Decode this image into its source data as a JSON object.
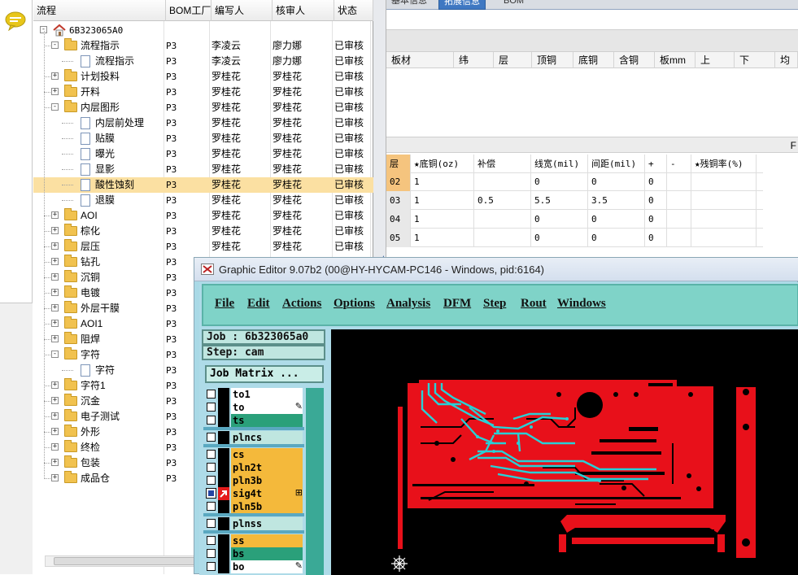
{
  "tree": {
    "headers": {
      "flow": "流程",
      "bom": "BOM工厂",
      "writer": "编写人",
      "auditor": "核审人",
      "status": "状态"
    },
    "root": "6B323065A0",
    "rows": [
      {
        "level": 1,
        "type": "folder",
        "expander": "-",
        "label": "流程指示",
        "bom": "P3",
        "writer": "李凌云",
        "auditor": "廖力娜",
        "status": "已审核"
      },
      {
        "level": 2,
        "type": "doc",
        "expander": "",
        "label": "流程指示",
        "bom": "P3",
        "writer": "李凌云",
        "auditor": "廖力娜",
        "status": "已审核"
      },
      {
        "level": 1,
        "type": "folder",
        "expander": "+",
        "label": "计划投料",
        "bom": "P3",
        "writer": "罗桂花",
        "auditor": "罗桂花",
        "status": "已审核"
      },
      {
        "level": 1,
        "type": "folder",
        "expander": "+",
        "label": "开料",
        "bom": "P3",
        "writer": "罗桂花",
        "auditor": "罗桂花",
        "status": "已审核"
      },
      {
        "level": 1,
        "type": "folder",
        "expander": "-",
        "label": "内层图形",
        "bom": "P3",
        "writer": "罗桂花",
        "auditor": "罗桂花",
        "status": "已审核"
      },
      {
        "level": 2,
        "type": "doc",
        "expander": "",
        "label": "内层前处理",
        "bom": "P3",
        "writer": "罗桂花",
        "auditor": "罗桂花",
        "status": "已审核"
      },
      {
        "level": 2,
        "type": "doc",
        "expander": "",
        "label": "贴膜",
        "bom": "P3",
        "writer": "罗桂花",
        "auditor": "罗桂花",
        "status": "已审核"
      },
      {
        "level": 2,
        "type": "doc",
        "expander": "",
        "label": "曝光",
        "bom": "P3",
        "writer": "罗桂花",
        "auditor": "罗桂花",
        "status": "已审核"
      },
      {
        "level": 2,
        "type": "doc",
        "expander": "",
        "label": "显影",
        "bom": "P3",
        "writer": "罗桂花",
        "auditor": "罗桂花",
        "status": "已审核"
      },
      {
        "level": 2,
        "type": "doc",
        "expander": "",
        "label": "酸性蚀刻",
        "bom": "P3",
        "writer": "罗桂花",
        "auditor": "罗桂花",
        "status": "已审核",
        "selected": true
      },
      {
        "level": 2,
        "type": "doc",
        "expander": "",
        "label": "退膜",
        "bom": "P3",
        "writer": "罗桂花",
        "auditor": "罗桂花",
        "status": "已审核"
      },
      {
        "level": 1,
        "type": "folder",
        "expander": "+",
        "label": "AOI",
        "bom": "P3",
        "writer": "罗桂花",
        "auditor": "罗桂花",
        "status": "已审核"
      },
      {
        "level": 1,
        "type": "folder",
        "expander": "+",
        "label": "棕化",
        "bom": "P3",
        "writer": "罗桂花",
        "auditor": "罗桂花",
        "status": "已审核"
      },
      {
        "level": 1,
        "type": "folder",
        "expander": "+",
        "label": "层压",
        "bom": "P3",
        "writer": "罗桂花",
        "auditor": "罗桂花",
        "status": "已审核"
      },
      {
        "level": 1,
        "type": "folder",
        "expander": "+",
        "label": "钻孔",
        "bom": "P3",
        "writer": "",
        "auditor": "",
        "status": ""
      },
      {
        "level": 1,
        "type": "folder",
        "expander": "+",
        "label": "沉铜",
        "bom": "P3",
        "writer": "",
        "auditor": "",
        "status": ""
      },
      {
        "level": 1,
        "type": "folder",
        "expander": "+",
        "label": "电镀",
        "bom": "P3",
        "writer": "",
        "auditor": "",
        "status": ""
      },
      {
        "level": 1,
        "type": "folder",
        "expander": "+",
        "label": "外层干膜",
        "bom": "P3",
        "writer": "",
        "auditor": "",
        "status": ""
      },
      {
        "level": 1,
        "type": "folder",
        "expander": "+",
        "label": "AOI1",
        "bom": "P3",
        "writer": "",
        "auditor": "",
        "status": ""
      },
      {
        "level": 1,
        "type": "folder",
        "expander": "+",
        "label": "阻焊",
        "bom": "P3",
        "writer": "",
        "auditor": "",
        "status": ""
      },
      {
        "level": 1,
        "type": "folder",
        "expander": "-",
        "label": "字符",
        "bom": "P3",
        "writer": "",
        "auditor": "",
        "status": ""
      },
      {
        "level": 2,
        "type": "doc",
        "expander": "",
        "label": "字符",
        "bom": "P3",
        "writer": "",
        "auditor": "",
        "status": ""
      },
      {
        "level": 1,
        "type": "folder",
        "expander": "+",
        "label": "字符1",
        "bom": "P3",
        "writer": "",
        "auditor": "",
        "status": ""
      },
      {
        "level": 1,
        "type": "folder",
        "expander": "+",
        "label": "沉金",
        "bom": "P3",
        "writer": "",
        "auditor": "",
        "status": ""
      },
      {
        "level": 1,
        "type": "folder",
        "expander": "+",
        "label": "电子测试",
        "bom": "P3",
        "writer": "",
        "auditor": "",
        "status": ""
      },
      {
        "level": 1,
        "type": "folder",
        "expander": "+",
        "label": "外形",
        "bom": "P3",
        "writer": "",
        "auditor": "",
        "status": ""
      },
      {
        "level": 1,
        "type": "folder",
        "expander": "+",
        "label": "终检",
        "bom": "P3",
        "writer": "",
        "auditor": "",
        "status": ""
      },
      {
        "level": 1,
        "type": "folder",
        "expander": "+",
        "label": "包装",
        "bom": "P3",
        "writer": "",
        "auditor": "",
        "status": ""
      },
      {
        "level": 1,
        "type": "folder",
        "expander": "+",
        "label": "成品仓",
        "bom": "P3",
        "writer": "",
        "auditor": "",
        "status": ""
      }
    ]
  },
  "right": {
    "tabs": [
      "基本信息",
      "拓展信息",
      "BOM"
    ],
    "board_headers": [
      "板材",
      "纬",
      "层",
      "顶铜",
      "底铜",
      "含铜",
      "板mm",
      "上",
      "下",
      "均"
    ],
    "sep_mark": "F",
    "layer_headers": [
      "层",
      "★底铜(oz)",
      "补偿",
      "线宽(mil)",
      "间距(mil)",
      "+",
      "-",
      "★残铜率(%)"
    ],
    "layer_rows": [
      [
        "02",
        "1",
        "",
        "0",
        "0",
        "0",
        "",
        ""
      ],
      [
        "03",
        "1",
        "0.5",
        "5.5",
        "3.5",
        "0",
        "",
        ""
      ],
      [
        "04",
        "1",
        "",
        "0",
        "0",
        "0",
        "",
        ""
      ],
      [
        "05",
        "1",
        "",
        "0",
        "0",
        "0",
        "",
        ""
      ]
    ]
  },
  "graphic_editor": {
    "title": "Graphic Editor 9.07b2 (00@HY-HYCAM-PC146 - Windows, pid:6164)",
    "menu": [
      "File",
      "Edit",
      "Actions",
      "Options",
      "Analysis",
      "DFM",
      "Step",
      "Rout",
      "Windows"
    ],
    "job": "Job : 6b323065a0",
    "step": "Step: cam",
    "job_matrix": "Job Matrix ...",
    "layers": [
      {
        "name": "to1",
        "color": "white",
        "group": 0,
        "edit": ""
      },
      {
        "name": "to",
        "color": "white",
        "group": 0,
        "edit": "✎"
      },
      {
        "name": "ts",
        "color": "green",
        "group": 0,
        "edit": ""
      },
      {
        "name": "plncs",
        "color": "cyan",
        "group": 1,
        "edit": ""
      },
      {
        "name": "cs",
        "color": "orange",
        "group": 2,
        "edit": ""
      },
      {
        "name": "pln2t",
        "color": "orange",
        "group": 2,
        "edit": ""
      },
      {
        "name": "pln3b",
        "color": "orange",
        "group": 2,
        "edit": ""
      },
      {
        "name": "sig4t",
        "color": "orange",
        "group": 2,
        "edit": "⊞",
        "checked": true
      },
      {
        "name": "pln5b",
        "color": "orange",
        "group": 2,
        "edit": ""
      },
      {
        "name": "plnss",
        "color": "cyan",
        "group": 3,
        "edit": ""
      },
      {
        "name": "ss",
        "color": "orange",
        "group": 4,
        "edit": ""
      },
      {
        "name": "bs",
        "color": "green",
        "group": 4,
        "edit": ""
      },
      {
        "name": "bo",
        "color": "white",
        "group": 4,
        "edit": "✎"
      }
    ]
  },
  "colors": {
    "copper_red": "#e8101a",
    "trace_cyan": "#28d0d6",
    "menu_teal": "#7fd3c8",
    "selection": "#fbe0a2"
  }
}
